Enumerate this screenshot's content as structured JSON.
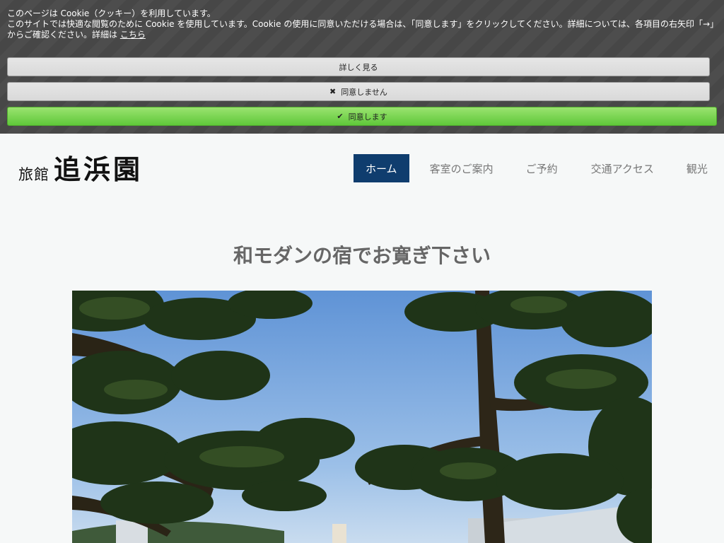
{
  "cookie": {
    "line1": "このページは Cookie（クッキー）を利用しています。",
    "line2": "このサイトでは快適な閲覧のために Cookie を使用しています。Cookie の使用に同意いただける場合は、「同意します」をクリックしてください。詳細については、各項目の右矢印「→」からご確認ください。詳細は",
    "link": "こちら",
    "details_label": "詳しく見る",
    "decline_label": "同意しません",
    "accept_label": "同意します"
  },
  "logo": {
    "small": "旅館",
    "big": "追浜園"
  },
  "nav": {
    "items": [
      {
        "label": "ホーム",
        "active": true
      },
      {
        "label": "客室のご案内",
        "active": false
      },
      {
        "label": "ご予約",
        "active": false
      },
      {
        "label": "交通アクセス",
        "active": false
      },
      {
        "label": "観光",
        "active": false
      }
    ]
  },
  "main": {
    "heading": "和モダンの宿でお寛ぎ下さい"
  },
  "colors": {
    "nav_active": "#0f3d6e",
    "accept_button": "#6fd14a",
    "banner_bg": "#474747"
  }
}
